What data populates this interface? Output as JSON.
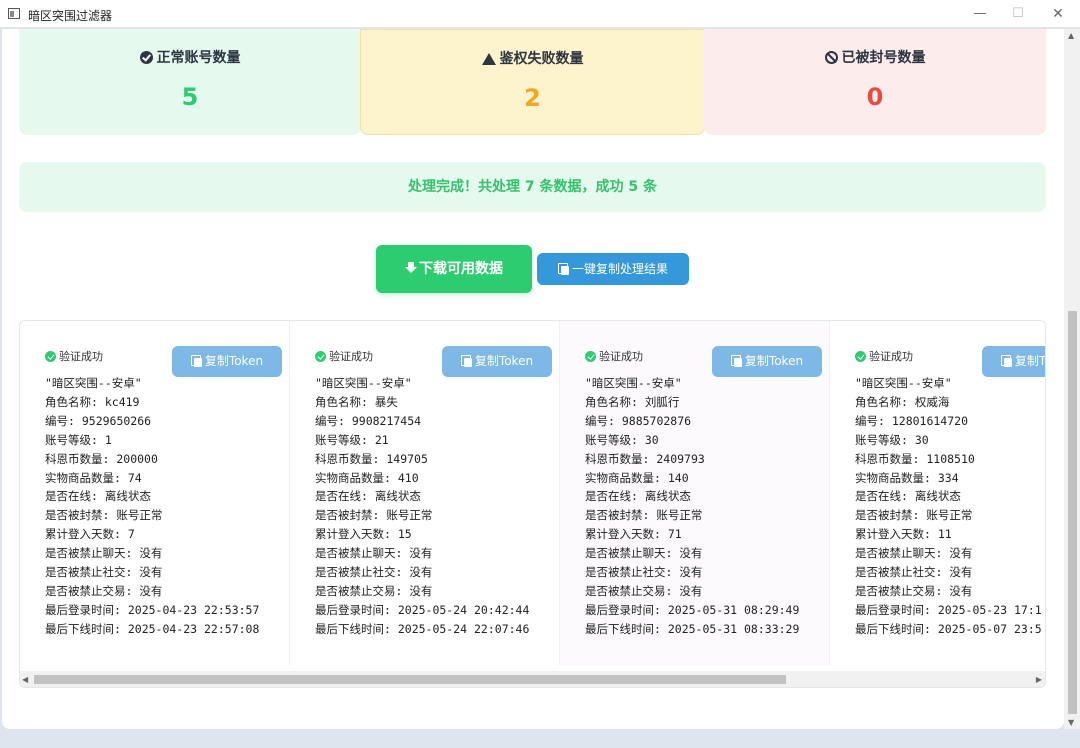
{
  "window": {
    "title": "暗区突围过滤器",
    "min": "—",
    "max": "☐",
    "close": "✕"
  },
  "stats": {
    "ok": {
      "label": "正常账号数量",
      "value": "5"
    },
    "fail": {
      "label": "鉴权失败数量",
      "value": "2"
    },
    "banned": {
      "label": "已被封号数量",
      "value": "0"
    }
  },
  "banner": "处理完成！共处理 7 条数据，成功 5 条",
  "buttons": {
    "download": "下载可用数据",
    "copy_all": "一键复制处理结果"
  },
  "results": [
    {
      "status": "验证成功",
      "copy_label": "复制Token",
      "lines": [
        "\"暗区突围--安卓\"",
        "角色名称: kc419",
        "编号: 9529650266",
        "账号等级: 1",
        "科恩币数量: 200000",
        "实物商品数量: 74",
        "是否在线: 离线状态",
        "是否被封禁: 账号正常",
        "累计登入天数: 7",
        "是否被禁止聊天: 没有",
        "是否被禁止社交: 没有",
        "是否被禁止交易: 没有",
        "最后登录时间: 2025-04-23 22:53:57",
        "最后下线时间: 2025-04-23 22:57:08"
      ]
    },
    {
      "status": "验证成功",
      "copy_label": "复制Token",
      "lines": [
        "\"暗区突围--安卓\"",
        "角色名称: 暴失",
        "编号: 9908217454",
        "账号等级: 21",
        "科恩币数量: 149705",
        "实物商品数量: 410",
        "是否在线: 离线状态",
        "是否被封禁: 账号正常",
        "累计登入天数: 15",
        "是否被禁止聊天: 没有",
        "是否被禁止社交: 没有",
        "是否被禁止交易: 没有",
        "最后登录时间: 2025-05-24 20:42:44",
        "最后下线时间: 2025-05-24 22:07:46"
      ]
    },
    {
      "status": "验证成功",
      "copy_label": "复制Token",
      "lines": [
        "\"暗区突围--安卓\"",
        "角色名称: 刘胍行",
        "编号: 9885702876",
        "账号等级: 30",
        "科恩币数量: 2409793",
        "实物商品数量: 140",
        "是否在线: 离线状态",
        "是否被封禁: 账号正常",
        "累计登入天数: 71",
        "是否被禁止聊天: 没有",
        "是否被禁止社交: 没有",
        "是否被禁止交易: 没有",
        "最后登录时间: 2025-05-31 08:29:49",
        "最后下线时间: 2025-05-31 08:33:29"
      ]
    },
    {
      "status": "验证成功",
      "copy_label": "复制Token",
      "lines": [
        "\"暗区突围--安卓\"",
        "角色名称: 权威海",
        "编号: 12801614720",
        "账号等级: 30",
        "科恩币数量: 1108510",
        "实物商品数量: 334",
        "是否在线: 离线状态",
        "是否被封禁: 账号正常",
        "累计登入天数: 11",
        "是否被禁止聊天: 没有",
        "是否被禁止社交: 没有",
        "是否被禁止交易: 没有",
        "最后登录时间: 2025-05-23 17:1",
        "最后下线时间: 2025-05-07 23:5"
      ]
    }
  ]
}
